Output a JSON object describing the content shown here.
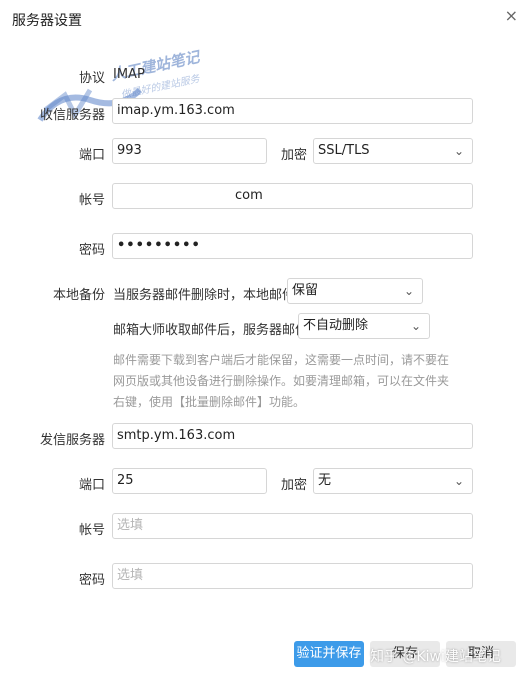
{
  "dialog": {
    "title": "服务器设置",
    "close_icon": "close-icon"
  },
  "watermark": {
    "text": "人工建站笔记",
    "sub": "做最好的建站服务",
    "bottom": "知乎 @Kiwi建站笔记"
  },
  "incoming": {
    "protocol_label": "协议",
    "protocol_value": "IMAP",
    "server_label": "收信服务器",
    "server_value": "imap.ym.163.com",
    "port_label": "端口",
    "port_value": "993",
    "encrypt_label": "加密",
    "encrypt_value": "SSL/TLS",
    "account_label": "帐号",
    "account_value": "com",
    "password_label": "密码",
    "password_value": "•••••••••"
  },
  "backup": {
    "label": "本地备份",
    "rule1_text": "当服务器邮件删除时，本地邮件",
    "rule1_value": "保留",
    "rule2_text": "邮箱大师收取邮件后，服务器邮件",
    "rule2_value": "不自动删除",
    "note": "邮件需要下载到客户端后才能保留，这需要一点时间，请不要在网页版或其他设备进行删除操作。如要清理邮箱，可以在文件夹右键，使用【批量删除邮件】功能。"
  },
  "outgoing": {
    "server_label": "发信服务器",
    "server_value": "smtp.ym.163.com",
    "port_label": "端口",
    "port_value": "25",
    "encrypt_label": "加密",
    "encrypt_value": "无",
    "account_label": "帐号",
    "account_placeholder": "选填",
    "password_label": "密码",
    "password_placeholder": "选填"
  },
  "footer": {
    "verify_save": "验证并保存",
    "save": "保存",
    "cancel": "取消"
  },
  "colors": {
    "primary": "#3d9be9",
    "border": "#d6d6d6",
    "note": "#9a9a9a"
  }
}
